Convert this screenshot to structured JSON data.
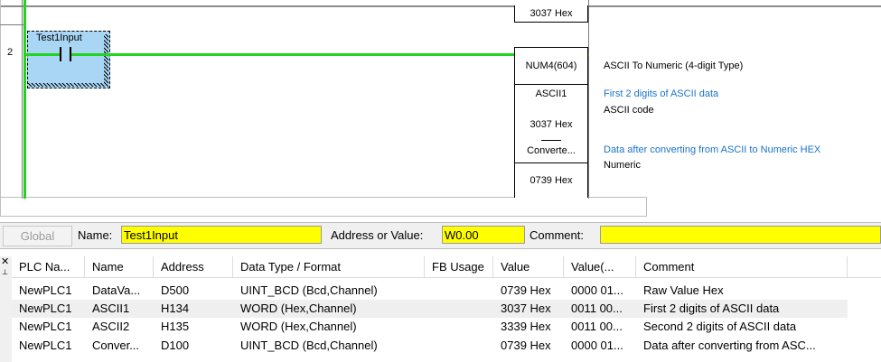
{
  "ladder": {
    "rung_number": "2",
    "top_value": "3037 Hex",
    "contact_label": "Test1Input",
    "fb": {
      "instruction": "NUM4(604)",
      "operand1": "ASCII1",
      "operand1_value": "3037 Hex",
      "operand2": "Converte...",
      "operand2_value": "0739 Hex"
    },
    "comments": {
      "instruction": "ASCII To Numeric (4-digit Type)",
      "op1_comment": "First 2 digits of ASCII data",
      "op1_type": "ASCII code",
      "op2_comment": "Data after converting from ASCII to Numeric HEX",
      "op2_type": "Numeric"
    }
  },
  "toolbar": {
    "global_label": "Global",
    "name_label": "Name:",
    "name_value": "Test1Input",
    "address_label": "Address or Value:",
    "address_value": "W0.00",
    "comment_label": "Comment:",
    "comment_value": ""
  },
  "table": {
    "columns": [
      "PLC Na...",
      "Name",
      "Address",
      "Data Type / Format",
      "FB Usage",
      "Value",
      "Value(...",
      "Comment"
    ],
    "rows": [
      [
        "NewPLC1",
        "DataVa...",
        "D500",
        "UINT_BCD (Bcd,Channel)",
        "",
        "0739 Hex",
        "0000 01...",
        "Raw Value Hex"
      ],
      [
        "NewPLC1",
        "ASCII1",
        "H134",
        "WORD (Hex,Channel)",
        "",
        "3037 Hex",
        "0011 00...",
        "First 2 digits of ASCII data"
      ],
      [
        "NewPLC1",
        "ASCII2",
        "H135",
        "WORD (Hex,Channel)",
        "",
        "3339 Hex",
        "0011 00...",
        "Second 2 digits of ASCII data"
      ],
      [
        "NewPLC1",
        "Conver...",
        "D100",
        "UINT_BCD (Bcd,Channel)",
        "",
        "0739 Hex",
        "0000 01...",
        "Data after converting from ASC..."
      ]
    ]
  },
  "colors": {
    "power_flow": "#22d322",
    "selection": "#a9d6f5",
    "field_highlight": "#ffff00",
    "comment_blue": "#1a73c9"
  }
}
